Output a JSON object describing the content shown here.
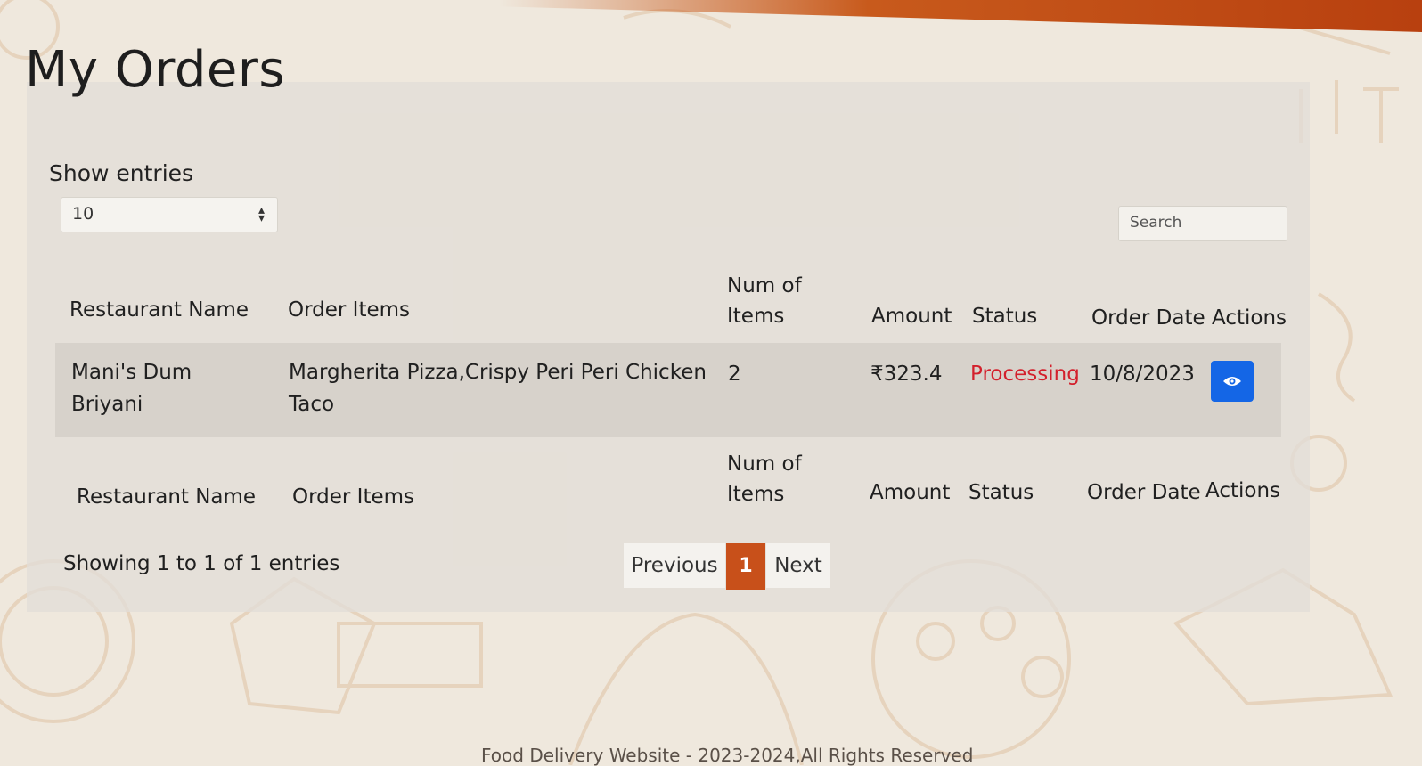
{
  "title": "My Orders",
  "length_menu": {
    "label": "Show entries",
    "value": "10"
  },
  "search": {
    "placeholder": "Search"
  },
  "table": {
    "headers": [
      "Restaurant Name",
      "Order Items",
      "Num of Items",
      "Amount",
      "Status",
      "Order Date",
      "Actions"
    ],
    "rows": [
      {
        "restaurant": "Mani's Dum Briyani",
        "items": "Margherita Pizza,Crispy Peri Peri Chicken Taco",
        "count": "2",
        "amount": "₹323.4",
        "status": "Processing",
        "date": "10/8/2023",
        "action_icon": "eye-icon"
      }
    ]
  },
  "info": "Showing 1 to 1 of 1 entries",
  "pagination": {
    "previous": "Previous",
    "current": "1",
    "next": "Next"
  },
  "footer": "Food Delivery Website - 2023-2024,All Rights Reserved",
  "colors": {
    "accent": "#c8501a",
    "status_processing": "#d3202c",
    "action_button": "#1466e6"
  }
}
